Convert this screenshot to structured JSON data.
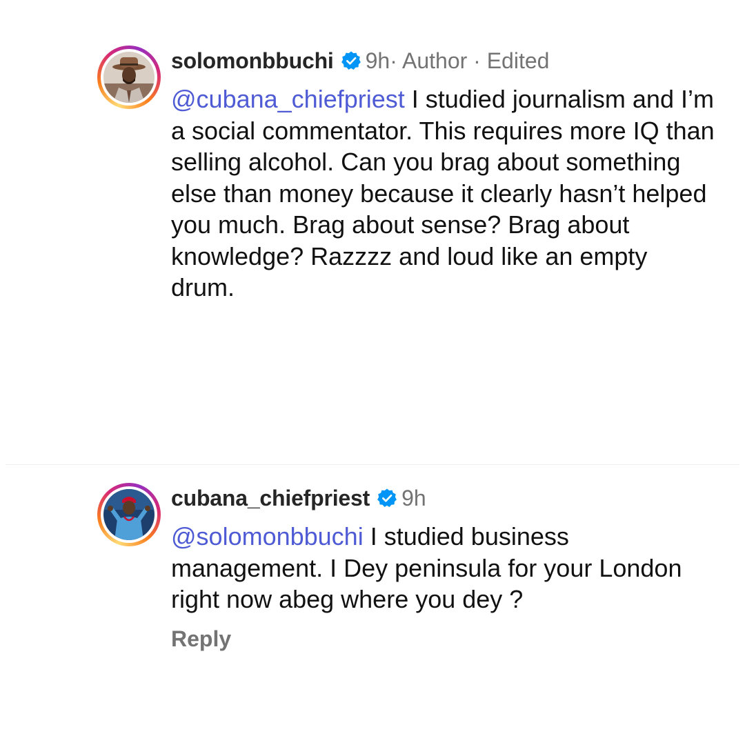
{
  "comments": [
    {
      "username": "solomonbbuchi",
      "verified": true,
      "time": "9h",
      "meta": " · Author · Edited",
      "mention": "@cubana_chiefpriest",
      "text": " I studied journalism and I’m a social commentator. This requires more IQ than selling alcohol. Can you brag about something else than money because it clearly hasn’t helped you much. Brag about sense? Brag about knowledge? Razzzz and loud like an empty drum."
    },
    {
      "username": "cubana_chiefpriest",
      "verified": true,
      "time": "9h",
      "meta": "",
      "mention": "@solomonbbuchi",
      "text": " I studied business management. I Dey peninsula for your London right now abeg where you dey ?",
      "reply_label": "Reply"
    }
  ],
  "colors": {
    "mention": "#4f5bd5",
    "verified_badge": "#0095f6",
    "meta_text": "#737373",
    "divider": "#ededed"
  },
  "icons": {
    "verified": "verified-badge-icon"
  }
}
